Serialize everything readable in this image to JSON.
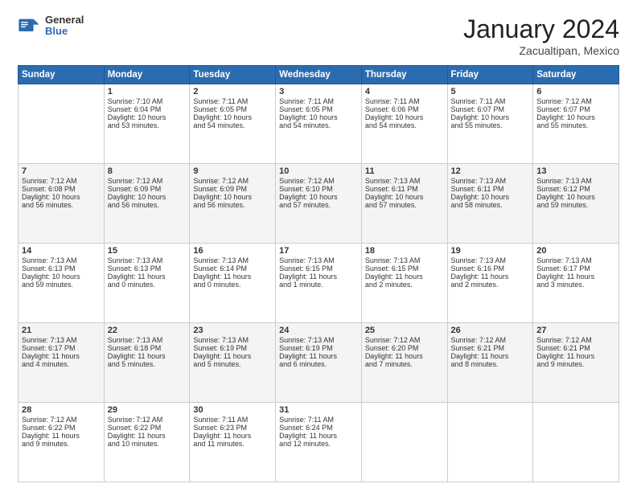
{
  "header": {
    "logo": {
      "general": "General",
      "blue": "Blue"
    },
    "title": "January 2024",
    "subtitle": "Zacualtipan, Mexico"
  },
  "weekdays": [
    "Sunday",
    "Monday",
    "Tuesday",
    "Wednesday",
    "Thursday",
    "Friday",
    "Saturday"
  ],
  "weeks": [
    [
      {
        "day": "",
        "info": ""
      },
      {
        "day": "1",
        "info": "Sunrise: 7:10 AM\nSunset: 6:04 PM\nDaylight: 10 hours\nand 53 minutes."
      },
      {
        "day": "2",
        "info": "Sunrise: 7:11 AM\nSunset: 6:05 PM\nDaylight: 10 hours\nand 54 minutes."
      },
      {
        "day": "3",
        "info": "Sunrise: 7:11 AM\nSunset: 6:05 PM\nDaylight: 10 hours\nand 54 minutes."
      },
      {
        "day": "4",
        "info": "Sunrise: 7:11 AM\nSunset: 6:06 PM\nDaylight: 10 hours\nand 54 minutes."
      },
      {
        "day": "5",
        "info": "Sunrise: 7:11 AM\nSunset: 6:07 PM\nDaylight: 10 hours\nand 55 minutes."
      },
      {
        "day": "6",
        "info": "Sunrise: 7:12 AM\nSunset: 6:07 PM\nDaylight: 10 hours\nand 55 minutes."
      }
    ],
    [
      {
        "day": "7",
        "info": "Sunrise: 7:12 AM\nSunset: 6:08 PM\nDaylight: 10 hours\nand 56 minutes."
      },
      {
        "day": "8",
        "info": "Sunrise: 7:12 AM\nSunset: 6:09 PM\nDaylight: 10 hours\nand 56 minutes."
      },
      {
        "day": "9",
        "info": "Sunrise: 7:12 AM\nSunset: 6:09 PM\nDaylight: 10 hours\nand 56 minutes."
      },
      {
        "day": "10",
        "info": "Sunrise: 7:12 AM\nSunset: 6:10 PM\nDaylight: 10 hours\nand 57 minutes."
      },
      {
        "day": "11",
        "info": "Sunrise: 7:13 AM\nSunset: 6:11 PM\nDaylight: 10 hours\nand 57 minutes."
      },
      {
        "day": "12",
        "info": "Sunrise: 7:13 AM\nSunset: 6:11 PM\nDaylight: 10 hours\nand 58 minutes."
      },
      {
        "day": "13",
        "info": "Sunrise: 7:13 AM\nSunset: 6:12 PM\nDaylight: 10 hours\nand 59 minutes."
      }
    ],
    [
      {
        "day": "14",
        "info": "Sunrise: 7:13 AM\nSunset: 6:13 PM\nDaylight: 10 hours\nand 59 minutes."
      },
      {
        "day": "15",
        "info": "Sunrise: 7:13 AM\nSunset: 6:13 PM\nDaylight: 11 hours\nand 0 minutes."
      },
      {
        "day": "16",
        "info": "Sunrise: 7:13 AM\nSunset: 6:14 PM\nDaylight: 11 hours\nand 0 minutes."
      },
      {
        "day": "17",
        "info": "Sunrise: 7:13 AM\nSunset: 6:15 PM\nDaylight: 11 hours\nand 1 minute."
      },
      {
        "day": "18",
        "info": "Sunrise: 7:13 AM\nSunset: 6:15 PM\nDaylight: 11 hours\nand 2 minutes."
      },
      {
        "day": "19",
        "info": "Sunrise: 7:13 AM\nSunset: 6:16 PM\nDaylight: 11 hours\nand 2 minutes."
      },
      {
        "day": "20",
        "info": "Sunrise: 7:13 AM\nSunset: 6:17 PM\nDaylight: 11 hours\nand 3 minutes."
      }
    ],
    [
      {
        "day": "21",
        "info": "Sunrise: 7:13 AM\nSunset: 6:17 PM\nDaylight: 11 hours\nand 4 minutes."
      },
      {
        "day": "22",
        "info": "Sunrise: 7:13 AM\nSunset: 6:18 PM\nDaylight: 11 hours\nand 5 minutes."
      },
      {
        "day": "23",
        "info": "Sunrise: 7:13 AM\nSunset: 6:19 PM\nDaylight: 11 hours\nand 5 minutes."
      },
      {
        "day": "24",
        "info": "Sunrise: 7:13 AM\nSunset: 6:19 PM\nDaylight: 11 hours\nand 6 minutes."
      },
      {
        "day": "25",
        "info": "Sunrise: 7:12 AM\nSunset: 6:20 PM\nDaylight: 11 hours\nand 7 minutes."
      },
      {
        "day": "26",
        "info": "Sunrise: 7:12 AM\nSunset: 6:21 PM\nDaylight: 11 hours\nand 8 minutes."
      },
      {
        "day": "27",
        "info": "Sunrise: 7:12 AM\nSunset: 6:21 PM\nDaylight: 11 hours\nand 9 minutes."
      }
    ],
    [
      {
        "day": "28",
        "info": "Sunrise: 7:12 AM\nSunset: 6:22 PM\nDaylight: 11 hours\nand 9 minutes."
      },
      {
        "day": "29",
        "info": "Sunrise: 7:12 AM\nSunset: 6:22 PM\nDaylight: 11 hours\nand 10 minutes."
      },
      {
        "day": "30",
        "info": "Sunrise: 7:11 AM\nSunset: 6:23 PM\nDaylight: 11 hours\nand 11 minutes."
      },
      {
        "day": "31",
        "info": "Sunrise: 7:11 AM\nSunset: 6:24 PM\nDaylight: 11 hours\nand 12 minutes."
      },
      {
        "day": "",
        "info": ""
      },
      {
        "day": "",
        "info": ""
      },
      {
        "day": "",
        "info": ""
      }
    ]
  ]
}
